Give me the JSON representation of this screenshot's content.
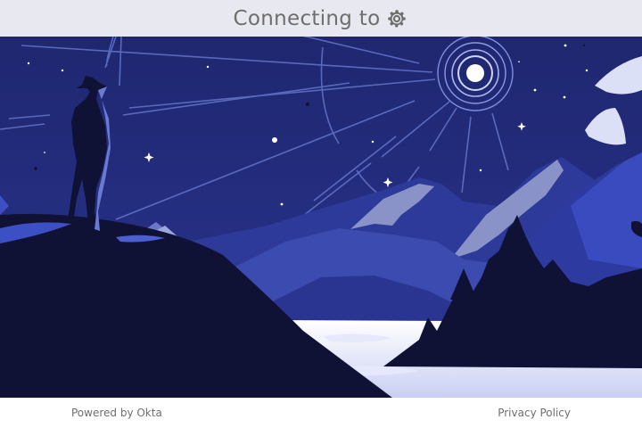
{
  "header": {
    "title": "Connecting to",
    "app_icon": "gear-icon"
  },
  "footer": {
    "powered_by": "Powered by Okta",
    "privacy_link": "Privacy Policy"
  },
  "colors": {
    "sky": "#222b78",
    "header_bg": "#e8e8f0",
    "text_gray": "#6e6e6e",
    "silhouette": "#0f1235"
  }
}
